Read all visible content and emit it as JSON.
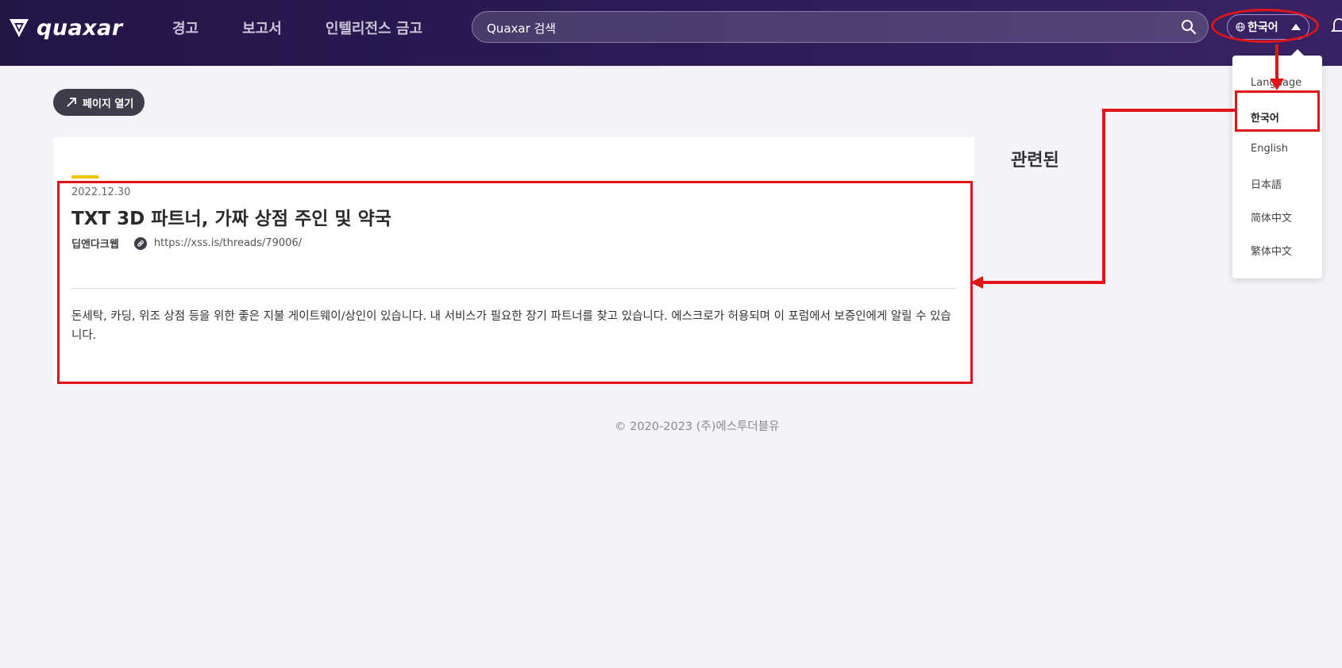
{
  "header": {
    "logo_text": "quaxar",
    "nav": [
      "경고",
      "보고서",
      "인텔리전스 금고"
    ],
    "search_placeholder": "Quaxar 검색",
    "language_button": "한국어"
  },
  "language_menu": {
    "items": [
      "Language",
      "한국어",
      "English",
      "日本語",
      "简体中文",
      "繁体中文"
    ],
    "selected": "한국어"
  },
  "page": {
    "open_page_button": "페이지 열기",
    "related_heading": "관련된"
  },
  "article": {
    "date": "2022.12.30",
    "title": "TXT 3D 파트너, 가짜 상점 주인 및 약국",
    "source": "딥앤다크웹",
    "url": "https://xss.is/threads/79006/",
    "body": "돈세탁, 카딩, 위조 상점 등을 위한 좋은 지불 게이트웨이/상인이 있습니다. 내 서비스가 필요한 장기 파트너를 찾고 있습니다. 에스크로가 허용되며 이 포럼에서 보증인에게 알릴 수 있습니다."
  },
  "footer": {
    "copyright": "© 2020-2023 (주)에스투더블유"
  },
  "colors": {
    "header_bg": "#2b1a55",
    "accent_yellow": "#f2c200",
    "annotation_red": "#e0151a",
    "page_bg": "#f3f3f8"
  }
}
